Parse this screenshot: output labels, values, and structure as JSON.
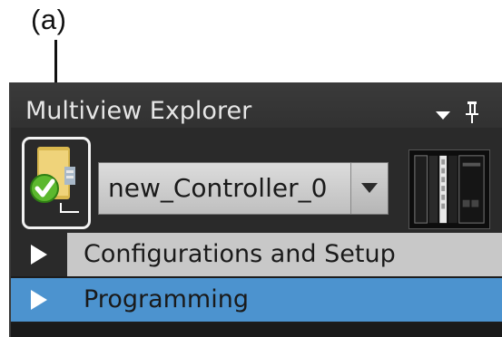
{
  "callout": {
    "label": "(a)"
  },
  "panel": {
    "title": "Multiview Explorer",
    "menu_icon": "dropdown-arrow-icon",
    "pin_icon": "pin-icon"
  },
  "controller": {
    "status_icon": "controller-online-icon",
    "selected": "new_Controller_0",
    "dropdown_icon": "chevron-down-icon",
    "image_icon": "controller-hardware-image"
  },
  "tree": {
    "items": [
      {
        "label": "Configurations and Setup",
        "expand_icon": "triangle-right-icon",
        "selected": false
      },
      {
        "label": "Programming",
        "expand_icon": "triangle-right-icon",
        "selected": true
      }
    ]
  },
  "colors": {
    "panel_bg": "#1c1c1c",
    "titlebar": "#333333",
    "selected_item": "#4c93cf",
    "config_item": "#c8c8c8",
    "status_check": "#5cb82e",
    "folder": "#e2c25c"
  }
}
